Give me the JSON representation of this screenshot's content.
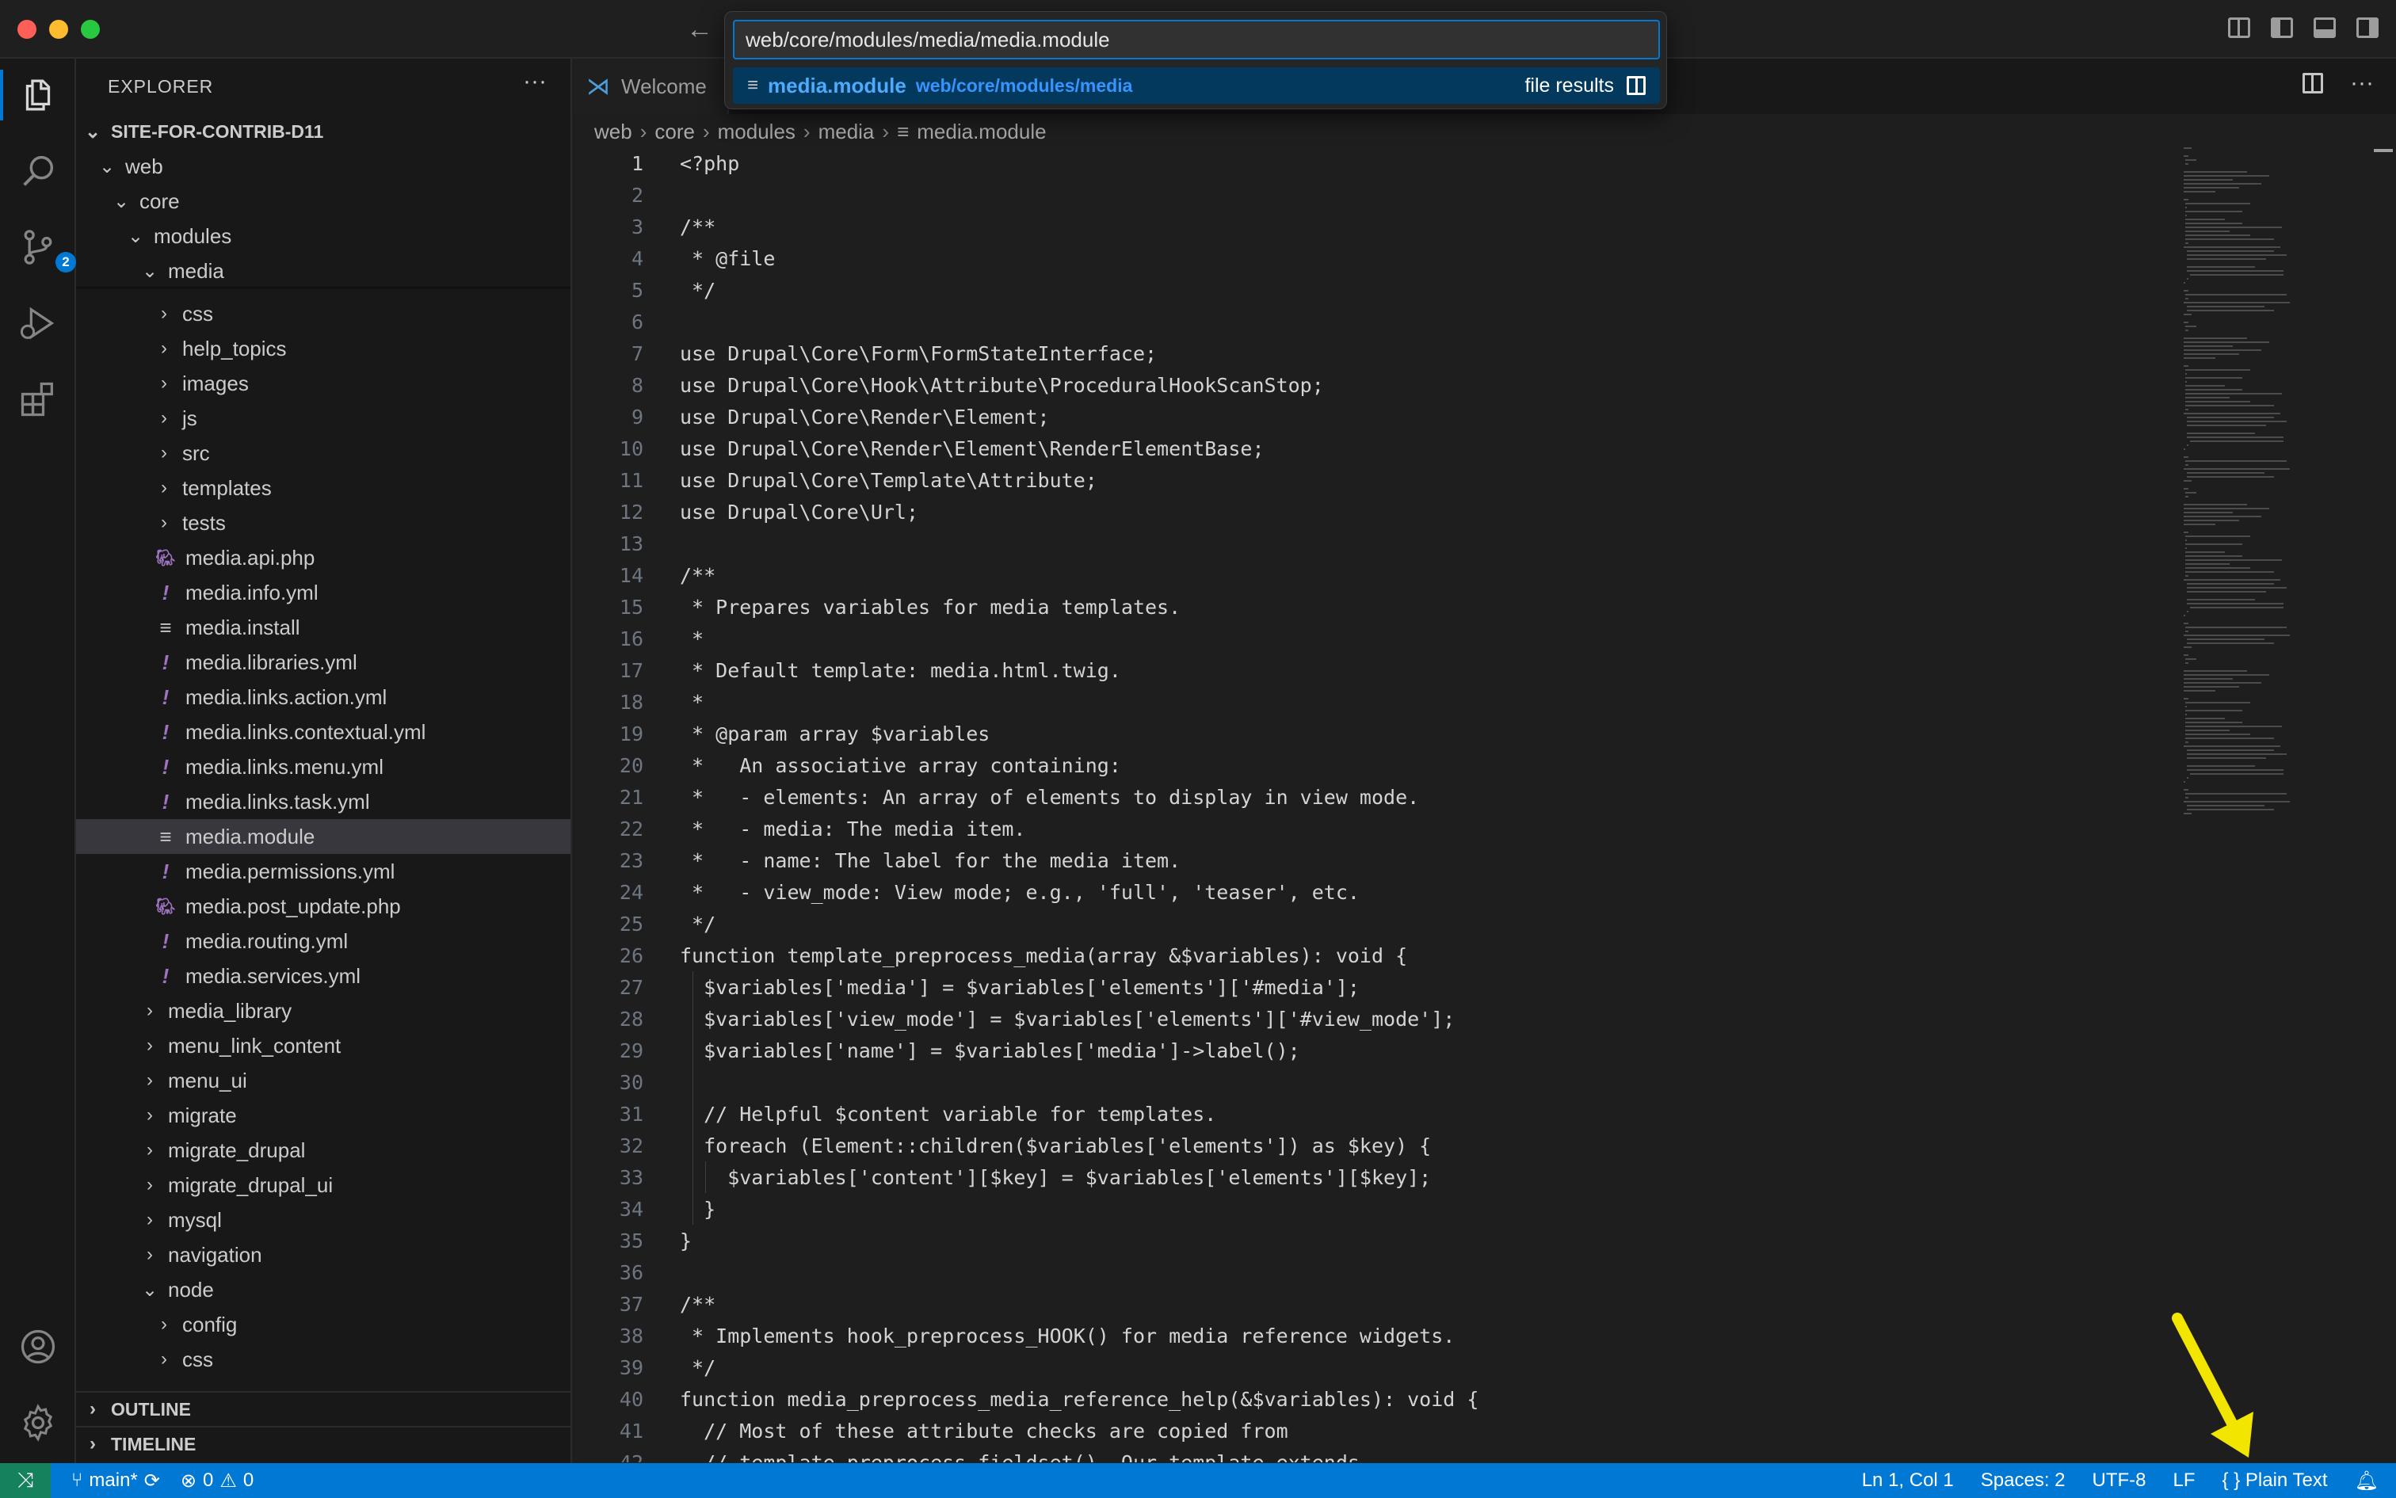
{
  "quick_open": {
    "query": "web/core/modules/media/media.module",
    "result_name": "media.module",
    "result_path": "web/core/modules/media",
    "result_kind": "file results"
  },
  "explorer": {
    "title": "EXPLORER",
    "more": "···",
    "root": "SITE-FOR-CONTRIB-D11",
    "rows": [
      {
        "label": "web",
        "type": "folder-open",
        "depth": 1
      },
      {
        "label": "core",
        "type": "folder-open",
        "depth": 2
      },
      {
        "label": "modules",
        "type": "folder-open",
        "depth": 3
      },
      {
        "label": "media",
        "type": "folder-open",
        "depth": 4
      },
      {
        "label": "css",
        "type": "folder",
        "depth": 5
      },
      {
        "label": "help_topics",
        "type": "folder",
        "depth": 5
      },
      {
        "label": "images",
        "type": "folder",
        "depth": 5
      },
      {
        "label": "js",
        "type": "folder",
        "depth": 5
      },
      {
        "label": "src",
        "type": "folder",
        "depth": 5
      },
      {
        "label": "templates",
        "type": "folder",
        "depth": 5
      },
      {
        "label": "tests",
        "type": "folder",
        "depth": 5
      },
      {
        "label": "media.api.php",
        "type": "php",
        "depth": 5
      },
      {
        "label": "media.info.yml",
        "type": "yml",
        "depth": 5
      },
      {
        "label": "media.install",
        "type": "txt",
        "depth": 5
      },
      {
        "label": "media.libraries.yml",
        "type": "yml",
        "depth": 5
      },
      {
        "label": "media.links.action.yml",
        "type": "yml",
        "depth": 5
      },
      {
        "label": "media.links.contextual.yml",
        "type": "yml",
        "depth": 5
      },
      {
        "label": "media.links.menu.yml",
        "type": "yml",
        "depth": 5
      },
      {
        "label": "media.links.task.yml",
        "type": "yml",
        "depth": 5
      },
      {
        "label": "media.module",
        "type": "txt",
        "depth": 5,
        "selected": true
      },
      {
        "label": "media.permissions.yml",
        "type": "yml",
        "depth": 5
      },
      {
        "label": "media.post_update.php",
        "type": "php",
        "depth": 5
      },
      {
        "label": "media.routing.yml",
        "type": "yml",
        "depth": 5
      },
      {
        "label": "media.services.yml",
        "type": "yml",
        "depth": 5
      },
      {
        "label": "media_library",
        "type": "folder",
        "depth": 4
      },
      {
        "label": "menu_link_content",
        "type": "folder",
        "depth": 4
      },
      {
        "label": "menu_ui",
        "type": "folder",
        "depth": 4
      },
      {
        "label": "migrate",
        "type": "folder",
        "depth": 4
      },
      {
        "label": "migrate_drupal",
        "type": "folder",
        "depth": 4
      },
      {
        "label": "migrate_drupal_ui",
        "type": "folder",
        "depth": 4
      },
      {
        "label": "mysql",
        "type": "folder",
        "depth": 4
      },
      {
        "label": "navigation",
        "type": "folder",
        "depth": 4
      },
      {
        "label": "node",
        "type": "folder-open",
        "depth": 4
      },
      {
        "label": "config",
        "type": "folder",
        "depth": 5
      },
      {
        "label": "css",
        "type": "folder",
        "depth": 5
      }
    ],
    "outline": "OUTLINE",
    "timeline": "TIMELINE",
    "scm_badge": "2"
  },
  "tabs": [
    {
      "label": "Welcome"
    }
  ],
  "breadcrumb": [
    "web",
    "core",
    "modules",
    "media",
    "media.module"
  ],
  "editor": {
    "lines": [
      "<?php",
      "",
      "/**",
      " * @file",
      " */",
      "",
      "use Drupal\\Core\\Form\\FormStateInterface;",
      "use Drupal\\Core\\Hook\\Attribute\\ProceduralHookScanStop;",
      "use Drupal\\Core\\Render\\Element;",
      "use Drupal\\Core\\Render\\Element\\RenderElementBase;",
      "use Drupal\\Core\\Template\\Attribute;",
      "use Drupal\\Core\\Url;",
      "",
      "/**",
      " * Prepares variables for media templates.",
      " *",
      " * Default template: media.html.twig.",
      " *",
      " * @param array $variables",
      " *   An associative array containing:",
      " *   - elements: An array of elements to display in view mode.",
      " *   - media: The media item.",
      " *   - name: The label for the media item.",
      " *   - view_mode: View mode; e.g., 'full', 'teaser', etc.",
      " */",
      "function template_preprocess_media(array &$variables): void {",
      "  $variables['media'] = $variables['elements']['#media'];",
      "  $variables['view_mode'] = $variables['elements']['#view_mode'];",
      "  $variables['name'] = $variables['media']->label();",
      "",
      "  // Helpful $content variable for templates.",
      "  foreach (Element::children($variables['elements']) as $key) {",
      "    $variables['content'][$key] = $variables['elements'][$key];",
      "  }",
      "}",
      "",
      "/**",
      " * Implements hook_preprocess_HOOK() for media reference widgets.",
      " */",
      "function media_preprocess_media_reference_help(&$variables): void {",
      "  // Most of these attribute checks are copied from",
      "  // template_preprocess_fieldset(). Our template extends"
    ]
  },
  "status": {
    "branch": "main*",
    "errors": "0",
    "warnings": "0",
    "position": "Ln 1, Col 1",
    "spaces": "Spaces: 2",
    "encoding": "UTF-8",
    "eol": "LF",
    "language": "Plain Text"
  },
  "colors": {
    "accent": "#0078d4",
    "statusbar": "#0078d4",
    "remote": "#16825d",
    "annotation_arrow": "#f2e600"
  }
}
